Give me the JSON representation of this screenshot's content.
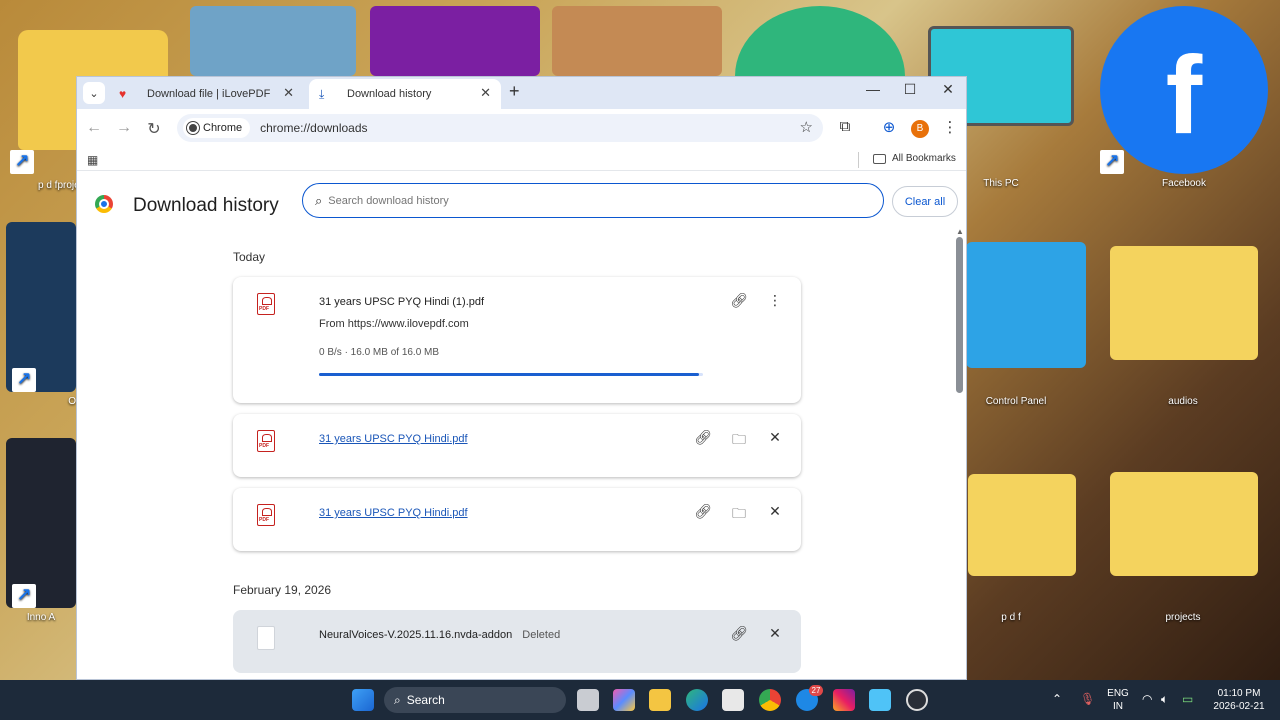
{
  "desktop": {
    "icons": [
      {
        "label": "p d fprojects"
      },
      {
        "label": "O"
      },
      {
        "label": "Inno A"
      },
      {
        "label": "This PC"
      },
      {
        "label": "Facebook"
      },
      {
        "label": "Control Panel"
      },
      {
        "label": "audios"
      },
      {
        "label": "p d f"
      },
      {
        "label": "projects"
      }
    ]
  },
  "browser": {
    "tabs": [
      {
        "label": "Download file | iLovePDF",
        "icon": "ilovepdf-heart-icon"
      },
      {
        "label": "Download history",
        "icon": "download-icon"
      }
    ],
    "chip_label": "Chrome",
    "url": "chrome://downloads",
    "avatar_letter": "B",
    "all_bookmarks": "All Bookmarks"
  },
  "page": {
    "title": "Download history",
    "search_placeholder": "Search download history",
    "clear_all": "Clear all",
    "sections": [
      {
        "label": "Today"
      },
      {
        "label": "February 19, 2026"
      }
    ],
    "downloads": [
      {
        "name": "31 years UPSC PYQ Hindi (1).pdf",
        "from": "From https://www.ilovepdf.com",
        "progress_text": "0 B/s · 16.0 MB of 16.0 MB",
        "progress": 0.99
      },
      {
        "name": "31 years UPSC PYQ Hindi.pdf"
      },
      {
        "name": "31 years UPSC PYQ Hindi.pdf"
      },
      {
        "name": "NeuralVoices-V.2025.11.16.nvda-addon",
        "status": "Deleted"
      }
    ]
  },
  "taskbar": {
    "search_label": "Search",
    "badge_count": "27",
    "language": "ENG",
    "region": "IN",
    "time": "01:10 PM",
    "date": "2026-02-21"
  },
  "colors": {
    "accent": "#0b57d0",
    "link": "#1a56b8",
    "pdf_red": "#c5221f",
    "tabstrip": "#dfe7f5",
    "taskbar": "#1d2a3a"
  }
}
